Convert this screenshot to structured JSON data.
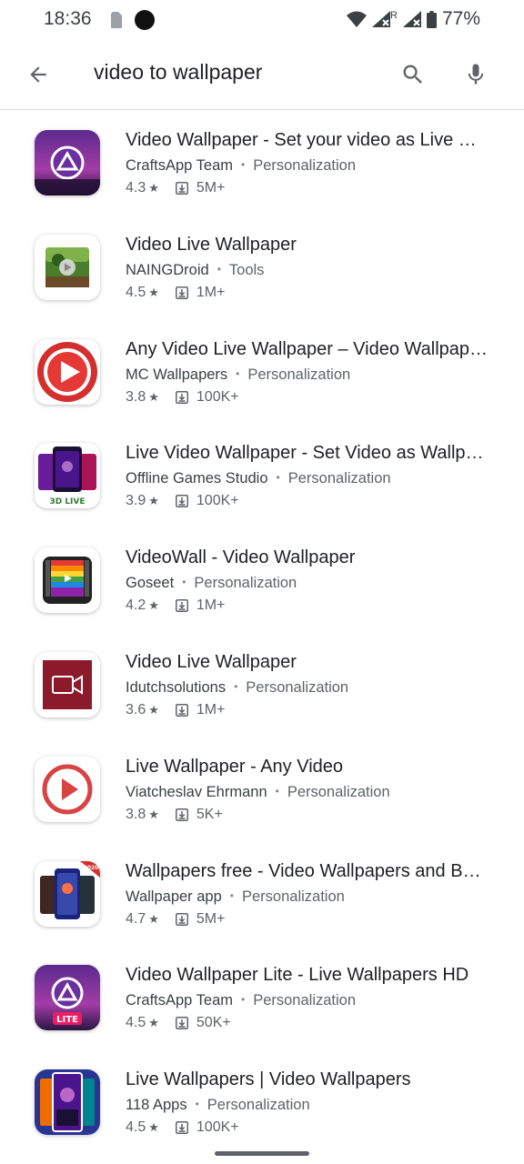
{
  "status": {
    "time": "18:36",
    "battery": "77%",
    "roaming": "R"
  },
  "search": {
    "query": "video to wallpaper"
  },
  "apps": [
    {
      "title": "Video Wallpaper - Set your video as Live Wallpaper",
      "developer": "CraftsApp Team",
      "category": "Personalization",
      "rating": "4.3",
      "downloads": "5M+"
    },
    {
      "title": "Video Live Wallpaper",
      "developer": "NAINGDroid",
      "category": "Tools",
      "rating": "4.5",
      "downloads": "1M+"
    },
    {
      "title": "Any Video Live Wallpaper – Video Wallpapers",
      "developer": "MC Wallpapers",
      "category": "Personalization",
      "rating": "3.8",
      "downloads": "100K+"
    },
    {
      "title": "Live Video Wallpaper - Set Video as Wallpaper",
      "developer": "Offline Games Studio",
      "category": "Personalization",
      "rating": "3.9",
      "downloads": "100K+",
      "icon_text": "3D LIVE"
    },
    {
      "title": "VideoWall - Video Wallpaper",
      "developer": "Goseet",
      "category": "Personalization",
      "rating": "4.2",
      "downloads": "1M+"
    },
    {
      "title": "Video Live Wallpaper",
      "developer": "Idutchsolutions",
      "category": "Personalization",
      "rating": "3.6",
      "downloads": "1M+"
    },
    {
      "title": "Live Wallpaper - Any Video",
      "developer": "Viatcheslav Ehrmann",
      "category": "Personalization",
      "rating": "3.8",
      "downloads": "5K+"
    },
    {
      "title": "Wallpapers free - Video Wallpapers and Backgrounds",
      "developer": "Wallpaper app",
      "category": "Personalization",
      "rating": "4.7",
      "downloads": "5M+",
      "icon_text": "2020"
    },
    {
      "title": "Video Wallpaper Lite - Live Wallpapers HD",
      "developer": "CraftsApp Team",
      "category": "Personalization",
      "rating": "4.5",
      "downloads": "50K+",
      "icon_text": "LITE"
    },
    {
      "title": "Live Wallpapers | Video Wallpapers",
      "developer": "118 Apps",
      "category": "Personalization",
      "rating": "4.5",
      "downloads": "100K+"
    }
  ],
  "colors": {
    "text_primary": "#202124",
    "text_secondary": "#5f6368",
    "divider": "#dadce0"
  }
}
